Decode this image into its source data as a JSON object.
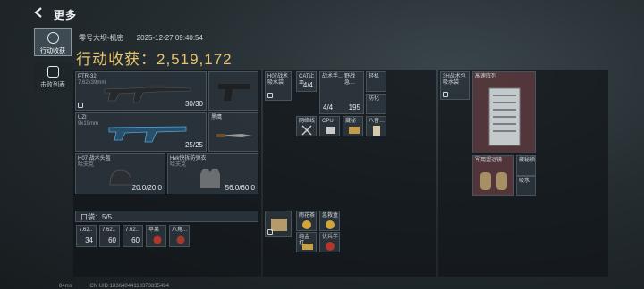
{
  "header": {
    "back_label": "",
    "title": "更多"
  },
  "sidebar": [
    {
      "label": "行动收获"
    },
    {
      "label": "击败列表"
    }
  ],
  "raid": {
    "map": "零号大坝-机密",
    "time": "2025-12-27 09:40:54",
    "harvest_label": "行动收获：",
    "harvest_value": "2,519,172"
  },
  "weapons": [
    {
      "name": "PTR-32",
      "sub": "7.62x39mm",
      "ammo": "30/30"
    },
    {
      "name": "UZI",
      "sub": "9x19mm",
      "ammo": "25/25"
    }
  ],
  "melee": {
    "name": "黑鹰"
  },
  "armor": [
    {
      "name": "H07 战术头盔",
      "sub": "哈夫克",
      "durability": "20.0/20.0"
    },
    {
      "name": "Hvk快拆防弹衣",
      "sub": "哈夫克",
      "durability": "56.0/60.0"
    }
  ],
  "pocket": {
    "label": "口袋：5/5",
    "items": [
      {
        "name": "7.62..",
        "count": "34"
      },
      {
        "name": "7.62..",
        "count": "60"
      },
      {
        "name": "7.62..",
        "count": "60"
      },
      {
        "name": "苹果"
      },
      {
        "name": "八角..."
      }
    ]
  },
  "rig": {
    "items": [
      {
        "name": "H07战术 吸水袋"
      },
      {
        "name": "CAT止血",
        "count": "4/4"
      },
      {
        "name": "战术手…",
        "count": "4/4"
      },
      {
        "name": "野战急…",
        "count": "195"
      },
      {
        "name": "轻机"
      },
      {
        "name": "网络线"
      },
      {
        "name": "CPU"
      },
      {
        "name": "藏秘"
      },
      {
        "name": "防化"
      },
      {
        "name": "八音…"
      }
    ]
  },
  "backpack": {
    "items": [
      {
        "name": ""
      },
      {
        "name": "雨花茶"
      },
      {
        "name": "急救盒"
      },
      {
        "name": "纯金打…"
      },
      {
        "name": "伏兵芋"
      }
    ]
  },
  "case": {
    "items": [
      {
        "name": "3H战术包",
        "sub": "吸水袋"
      },
      {
        "name": "高速阵列"
      },
      {
        "name": "军用望远镜"
      },
      {
        "name": "藏秘锁"
      },
      {
        "name": "吸水"
      }
    ]
  },
  "footer": {
    "ping": "84ms",
    "uid": "CN UID:18364044118373835494"
  }
}
